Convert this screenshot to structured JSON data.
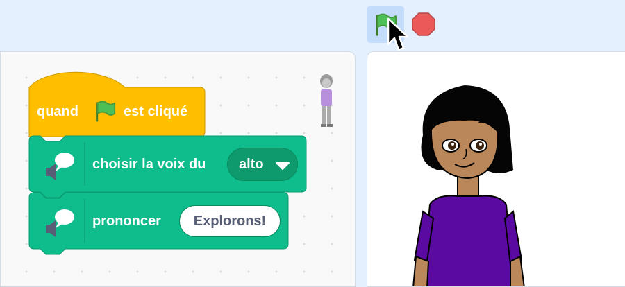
{
  "toolbar": {
    "green_flag_icon": "green-flag-icon",
    "stop_icon": "stop-sign-icon",
    "cursor_icon": "mouse-pointer-icon"
  },
  "code_area": {
    "hat_block": {
      "before_flag": "quand",
      "flag_icon": "green-flag-icon",
      "after_flag": "est cliqué"
    },
    "voice_block": {
      "icon": "text-to-speech-icon",
      "label": "choisir la voix du",
      "dropdown_value": "alto",
      "dropdown_icon": "triangle-down-icon"
    },
    "speak_block": {
      "icon": "text-to-speech-icon",
      "label": "prononcer",
      "input_value": "Explorons!"
    }
  },
  "colors": {
    "background": "#e5f0ff",
    "events_block": "#ffbf00",
    "extension_block": "#0fbd8c",
    "flag_button_active": "#c4dcfb",
    "stop_red": "#ec5959"
  }
}
